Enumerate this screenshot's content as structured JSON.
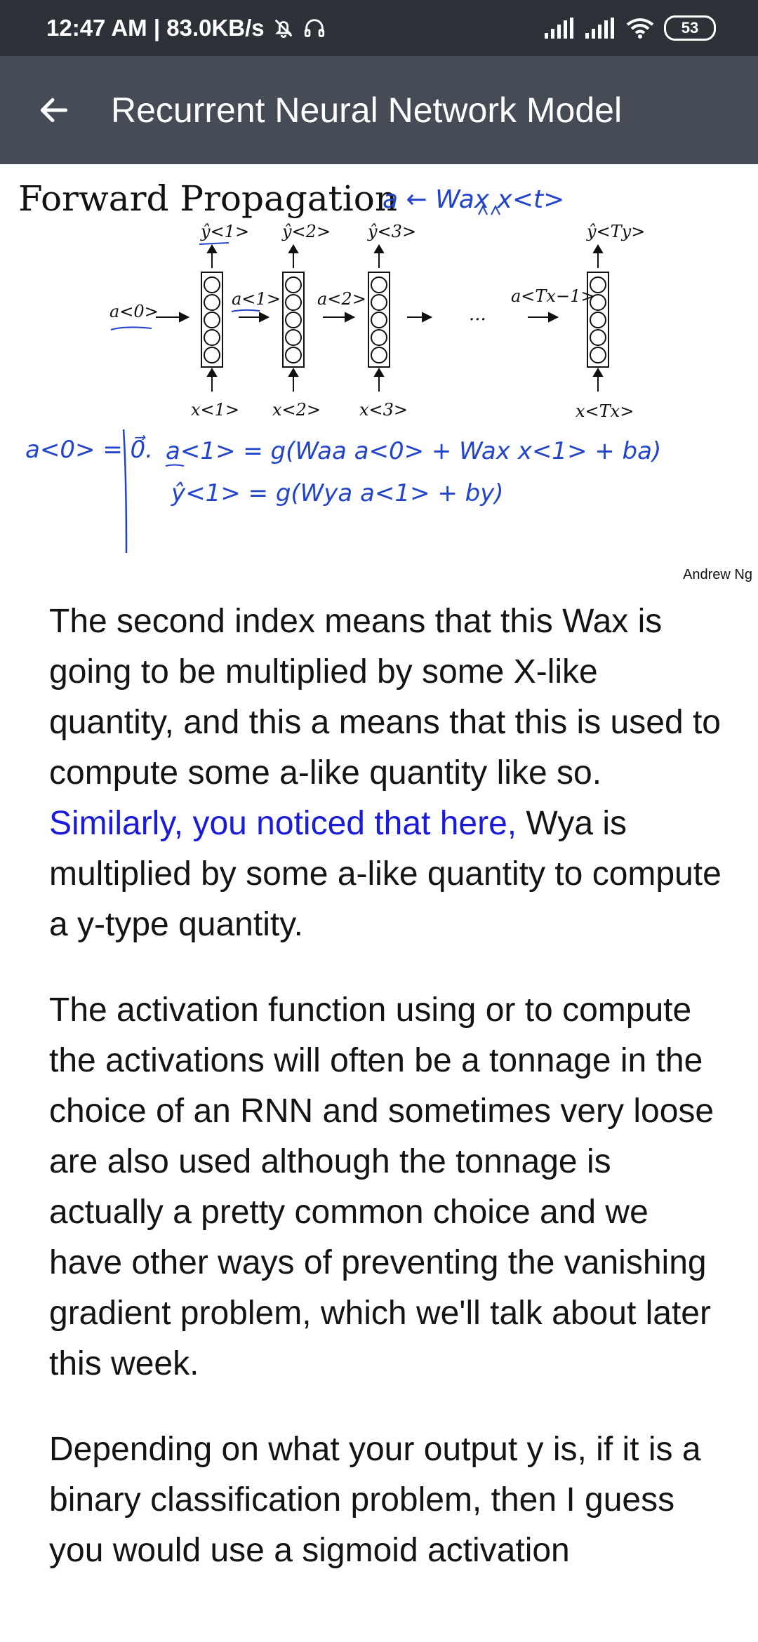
{
  "status_bar": {
    "time_info": "12:47 AM | 83.0KB/s",
    "battery_level": "53",
    "icons": [
      "mute-bell-icon",
      "headset-icon",
      "signal-icon",
      "signal-icon",
      "wifi-icon",
      "battery-icon"
    ]
  },
  "app_bar": {
    "back_icon": "arrow-left-icon",
    "title": "Recurrent Neural Network Model"
  },
  "slide": {
    "title": "Forward Propagation",
    "handwritten_top": "a ← Wax x<t>",
    "outputs": [
      "ŷ<1>",
      "ŷ<2>",
      "ŷ<3>",
      "ŷ<Ty>"
    ],
    "activations": [
      "a<0>",
      "a<1>",
      "a<2>",
      "a<Tx−1>"
    ],
    "ellipsis": "...",
    "inputs": [
      "x<1>",
      "x<2>",
      "x<3>",
      "x<Tx>"
    ],
    "handwritten_init": "a<0> = 0⃗.",
    "handwritten_eq1": "a<1> = g(Waa a<0> + Wax x<1> + ba)",
    "handwritten_eq2": "ŷ<1> = g(Wya a<1> + by)",
    "attribution": "Andrew Ng"
  },
  "transcript": {
    "p1_a": "The second index means that this Wax is going to be multiplied by some X-like quantity, and this a means that this is used to compute some a-like quantity like so. ",
    "p1_highlight": "Similarly, you noticed that here,",
    "p1_b": " Wya is multiplied by some a-like quantity to compute a y-type quantity.",
    "p2": "The activation function using or to compute the activations will often be a tonnage in the choice of an RNN and sometimes very loose are also used although the tonnage is actually a pretty common choice and we have other ways of preventing the vanishing gradient problem, which we'll talk about later this week.",
    "p3": "Depending on what your output y is, if it is a binary classification problem, then I guess you would use a sigmoid activation"
  },
  "colors": {
    "status_bar_bg": "#2d3238",
    "app_bar_bg": "#454c55",
    "handwriting_blue": "#2244cc",
    "highlight_blue": "#1a1adb"
  }
}
